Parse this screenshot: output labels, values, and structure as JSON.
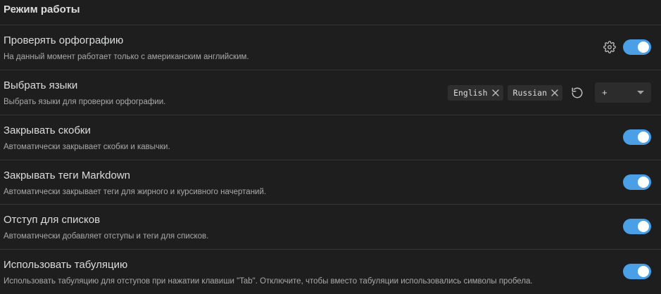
{
  "section": {
    "title": "Режим работы"
  },
  "settings": [
    {
      "name": "Проверять орфографию",
      "description": "На данный момент работает только с американским английским.",
      "enabled": true,
      "has_gear": true
    },
    {
      "name": "Выбрать языки",
      "description": "Выбрать языки для проверки орфографии.",
      "languages": [
        "English",
        "Russian"
      ],
      "add_select": {
        "value": "+"
      }
    },
    {
      "name": "Закрывать скобки",
      "description": "Автоматически закрывает скобки и кавычки.",
      "enabled": true
    },
    {
      "name": "Закрывать теги Markdown",
      "description": "Автоматически закрывает теги для жирного и курсивного начертаний.",
      "enabled": true
    },
    {
      "name": "Отступ для списков",
      "description": "Автоматически добавляет отступы и теги для списков.",
      "enabled": true
    },
    {
      "name": "Использовать табуляцию",
      "description": "Использовать табуляцию для отступов при нажатии клавиши \"Tab\". Отключите, чтобы вместо табуляции использовались символы пробела.",
      "enabled": true
    }
  ],
  "colors": {
    "background": "#1e1e1e",
    "toggle_on": "#4a9fe6",
    "divider": "#363636",
    "chip_bg": "#2e2e2e"
  },
  "icons": {
    "settings": "gear-icon",
    "remove": "close-icon",
    "reset": "reset-icon",
    "dropdown": "chevron-down-icon"
  }
}
